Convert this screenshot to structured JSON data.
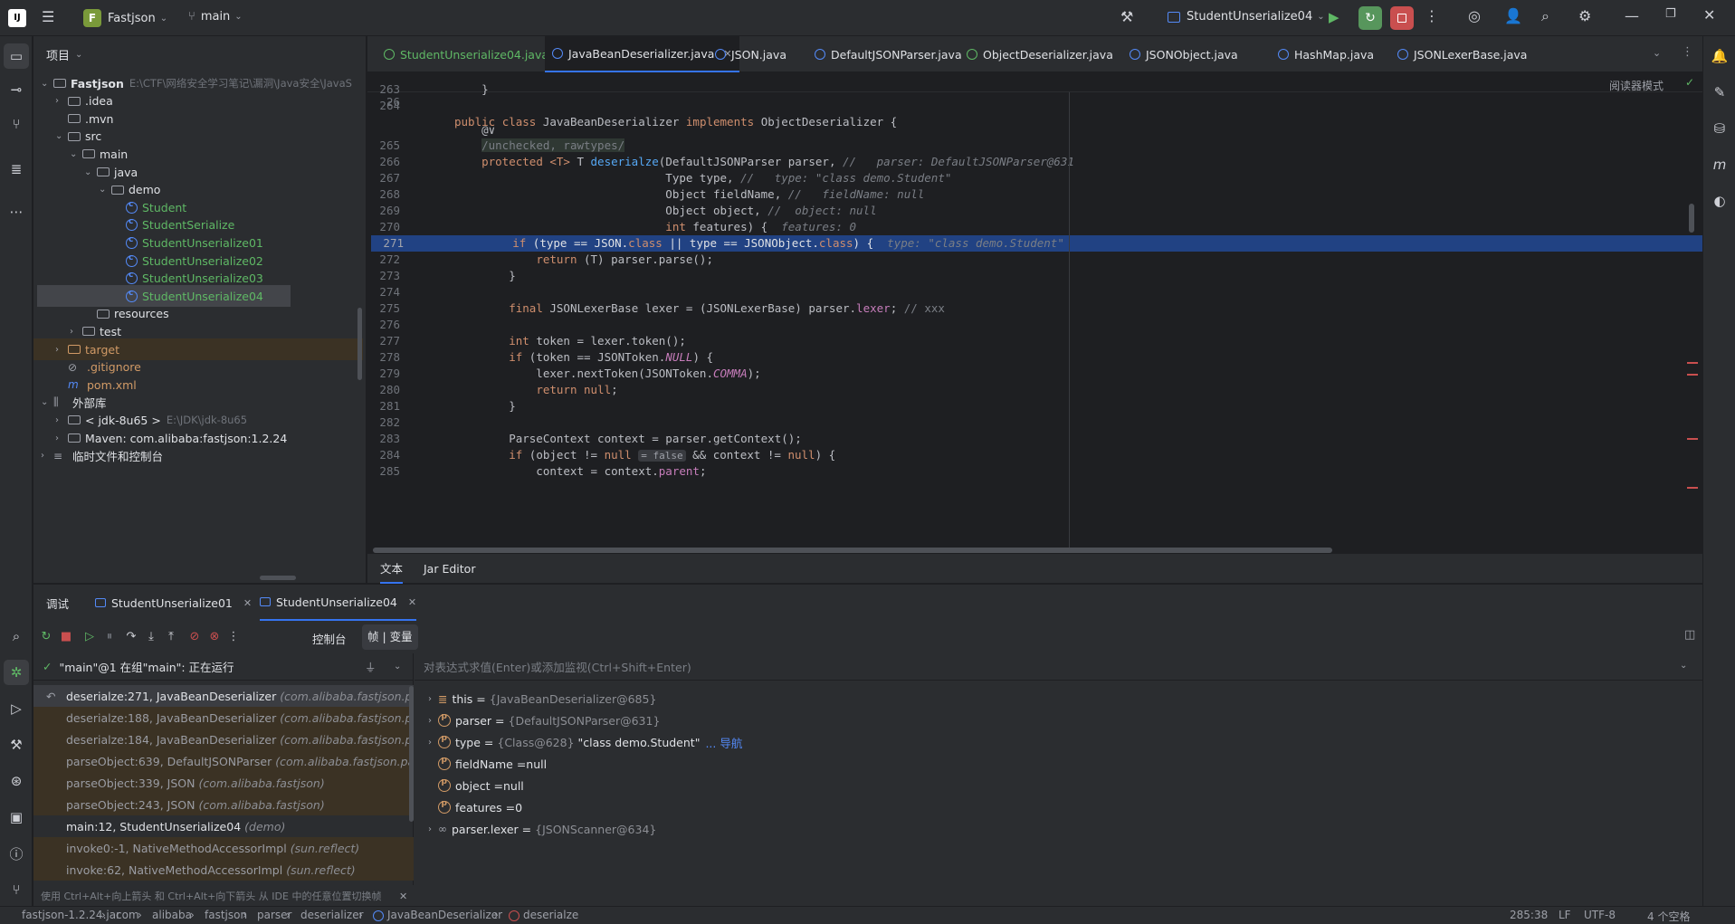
{
  "titlebar": {
    "project_initial": "F",
    "project_name": "Fastjson",
    "branch": "main",
    "run_config": "StudentUnserialize04"
  },
  "project_panel": {
    "title": "项目",
    "tree": [
      {
        "label": "Fastjson",
        "path": "E:\\CTF\\网络安全学习笔记\\漏洞\\Java安全\\JavaS",
        "kind": "root",
        "indent": 0,
        "open": true
      },
      {
        "label": ".idea",
        "kind": "folder",
        "indent": 1,
        "open": false
      },
      {
        "label": ".mvn",
        "kind": "folder",
        "indent": 1,
        "open": null
      },
      {
        "label": "src",
        "kind": "folder",
        "indent": 1,
        "open": true
      },
      {
        "label": "main",
        "kind": "folder",
        "indent": 2,
        "open": true
      },
      {
        "label": "java",
        "kind": "folder",
        "indent": 3,
        "open": true
      },
      {
        "label": "demo",
        "kind": "folder",
        "indent": 4,
        "open": true
      },
      {
        "label": "Student",
        "kind": "class",
        "indent": 5
      },
      {
        "label": "StudentSerialize",
        "kind": "class",
        "indent": 5
      },
      {
        "label": "StudentUnserialize01",
        "kind": "class",
        "indent": 5
      },
      {
        "label": "StudentUnserialize02",
        "kind": "class",
        "indent": 5
      },
      {
        "label": "StudentUnserialize03",
        "kind": "class",
        "indent": 5
      },
      {
        "label": "StudentUnserialize04",
        "kind": "class",
        "indent": 5,
        "selected": true
      },
      {
        "label": "resources",
        "kind": "folder",
        "indent": 3,
        "open": null
      },
      {
        "label": "test",
        "kind": "folder",
        "indent": 2,
        "open": false
      },
      {
        "label": "target",
        "kind": "folder-target",
        "indent": 1,
        "open": false
      },
      {
        "label": ".gitignore",
        "kind": "file-ignore",
        "indent": 1
      },
      {
        "label": "pom.xml",
        "kind": "file-maven",
        "indent": 1
      },
      {
        "label": "外部库",
        "kind": "lib",
        "indent": 0,
        "open": true
      },
      {
        "label": "< jdk-8u65 >",
        "path": "E:\\JDK\\jdk-8u65",
        "kind": "jdk",
        "indent": 1,
        "open": false
      },
      {
        "label": "Maven: com.alibaba:fastjson:1.2.24",
        "kind": "jar",
        "indent": 1,
        "open": false
      },
      {
        "label": "临时文件和控制台",
        "kind": "scratch",
        "indent": 0,
        "open": false
      }
    ]
  },
  "tabs": [
    {
      "label": "StudentUnserialize04.java",
      "icon": "green"
    },
    {
      "label": "JavaBeanDeserializer.java",
      "icon": "blue",
      "active": true
    },
    {
      "label": "JSON.java",
      "icon": "blue"
    },
    {
      "label": "DefaultJSONParser.java",
      "icon": "blue"
    },
    {
      "label": "ObjectDeserializer.java",
      "icon": "green"
    },
    {
      "label": "JSONObject.java",
      "icon": "blue"
    },
    {
      "label": "HashMap.java",
      "icon": "blue"
    },
    {
      "label": "JSONLexerBase.java",
      "icon": "blue"
    }
  ],
  "editor": {
    "reader_mode": "阅读器模式",
    "sticky_header": {
      "ln": "26",
      "text": "public class JavaBeanDeserializer implements ObjectDeserializer {"
    },
    "lines": [
      {
        "ln": "263",
        "text": "    }"
      },
      {
        "ln": "264",
        "text": ""
      },
      {
        "ln": "",
        "text": "    @∨"
      },
      {
        "ln": "265",
        "text": "    /unchecked, rawtypes/"
      },
      {
        "ln": "266",
        "text": "    protected <T> T deserialze(DefaultJSONParser parser, //   parser: DefaultJSONParser@631"
      },
      {
        "ln": "267",
        "text": "                               Type type, //   type: \"class demo.Student\""
      },
      {
        "ln": "268",
        "text": "                               Object fieldName, //   fieldName: null"
      },
      {
        "ln": "269",
        "text": "                               Object object, //  object: null"
      },
      {
        "ln": "270",
        "text": "                               int features) {  features: 0"
      },
      {
        "ln": "271",
        "text": "        if (type == JSON.class || type == JSONObject.class) {  type: \"class demo.Student\"",
        "highlight": true
      },
      {
        "ln": "272",
        "text": "            return (T) parser.parse();"
      },
      {
        "ln": "273",
        "text": "        }"
      },
      {
        "ln": "274",
        "text": ""
      },
      {
        "ln": "275",
        "text": "        final JSONLexerBase lexer = (JSONLexerBase) parser.lexer; // xxx"
      },
      {
        "ln": "276",
        "text": ""
      },
      {
        "ln": "277",
        "text": "        int token = lexer.token();"
      },
      {
        "ln": "278",
        "text": "        if (token == JSONToken.NULL) {"
      },
      {
        "ln": "279",
        "text": "            lexer.nextToken(JSONToken.COMMA);"
      },
      {
        "ln": "280",
        "text": "            return null;"
      },
      {
        "ln": "281",
        "text": "        }"
      },
      {
        "ln": "282",
        "text": ""
      },
      {
        "ln": "283",
        "text": "        ParseContext context = parser.getContext();"
      },
      {
        "ln": "284",
        "text": "        if (object != null = false && context != null) {"
      },
      {
        "ln": "285",
        "text": "            context = context.parent;"
      }
    ],
    "bottom_tabs": [
      "文本",
      "Jar Editor"
    ]
  },
  "debug": {
    "title": "调试",
    "sessions": [
      "StudentUnserialize01",
      "StudentUnserialize04"
    ],
    "console_tab": "控制台",
    "frames_tab": "帧 | 变量",
    "thread": "\"main\"@1 在组\"main\": 正在运行",
    "eval_placeholder": "对表达式求值(Enter)或添加监视(Ctrl+Shift+Enter)",
    "frames": [
      {
        "method": "deserialze:271, JavaBeanDeserializer",
        "pkg": "(com.alibaba.fastjson.parser.",
        "kind": "sel"
      },
      {
        "method": "deserialze:188, JavaBeanDeserializer",
        "pkg": "(com.alibaba.fastjson.parser.",
        "kind": "lib"
      },
      {
        "method": "deserialze:184, JavaBeanDeserializer",
        "pkg": "(com.alibaba.fastjson.parser.",
        "kind": "lib"
      },
      {
        "method": "parseObject:639, DefaultJSONParser",
        "pkg": "(com.alibaba.fastjson.parser)",
        "kind": "lib"
      },
      {
        "method": "parseObject:339, JSON",
        "pkg": "(com.alibaba.fastjson)",
        "kind": "lib"
      },
      {
        "method": "parseObject:243, JSON",
        "pkg": "(com.alibaba.fastjson)",
        "kind": "lib"
      },
      {
        "method": "main:12, StudentUnserialize04",
        "pkg": "(demo)",
        "kind": "user"
      },
      {
        "method": "invoke0:-1, NativeMethodAccessorImpl",
        "pkg": "(sun.reflect)",
        "kind": "lib"
      },
      {
        "method": "invoke:62, NativeMethodAccessorImpl",
        "pkg": "(sun.reflect)",
        "kind": "lib"
      }
    ],
    "frames_hint": "使用 Ctrl+Alt+向上箭头 和 Ctrl+Alt+向下箭头 从 IDE 中的任意位置切换帧",
    "variables": [
      {
        "name": "this",
        "value": "{JavaBeanDeserializer@685}",
        "expand": true
      },
      {
        "name": "parser",
        "value": "{DefaultJSONParser@631}",
        "expand": true
      },
      {
        "name": "type",
        "value": "{Class@628}",
        "str": "\"class demo.Student\"",
        "nav": "... 导航",
        "expand": true
      },
      {
        "name": "fieldName",
        "value": "null",
        "expand": false
      },
      {
        "name": "object",
        "value": "null",
        "expand": false
      },
      {
        "name": "features",
        "value": "0",
        "expand": false
      },
      {
        "name": "parser.lexer",
        "value": "{JSONScanner@634}",
        "expand": true,
        "watch": true
      }
    ]
  },
  "statusbar": {
    "crumbs": [
      "fastjson-1.2.24.jar",
      "com",
      "alibaba",
      "fastjson",
      "parser",
      "deserializer",
      "JavaBeanDeserializer",
      "deserialze"
    ],
    "position": "285:38",
    "line_sep": "LF",
    "encoding": "UTF-8",
    "indent": "4 个空格"
  }
}
